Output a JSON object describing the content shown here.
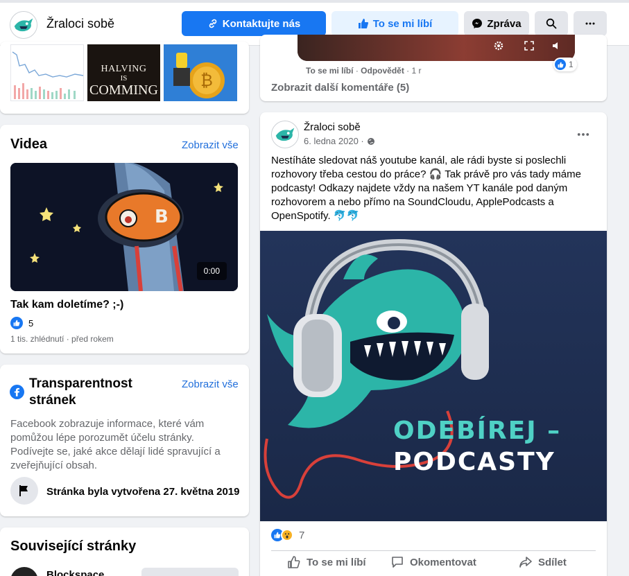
{
  "header": {
    "page_name": "Žraloci sobě",
    "contact_label": "Kontaktujte nás",
    "like_label": "To se mi líbí",
    "message_label": "Zpráva"
  },
  "photos": {
    "halving_text_1": "HALVING",
    "halving_text_2": "IS",
    "halving_text_3": "COMMING"
  },
  "videos": {
    "title": "Videa",
    "see_all": "Zobrazit vše",
    "duration": "0:00",
    "video_title": "Tak kam doletíme? ;-)",
    "likes": "5",
    "meta": "1 tis. zhlédnutí · před rokem"
  },
  "transparency": {
    "title_line1": "Transparentnost",
    "title_line2": "stránek",
    "see_all": "Zobrazit vše",
    "desc_line1": "Facebook zobrazuje informace, které vám",
    "desc_line2": "pomůžou lépe porozumět účelu stránky.",
    "desc_line3": "Podívejte se, jaké akce dělají lidé spravující a",
    "desc_line4": "zveřejňující obsah.",
    "created": "Stránka byla vytvořena 27. května 2019"
  },
  "related": {
    "title": "Související stránky",
    "first_page": "Blockspace"
  },
  "comment": {
    "like_link": "To se mi líbí",
    "reply_link": "Odpovědět",
    "time": "1 r",
    "reaction_count": "1",
    "more_comments": "Zobrazit další komentáře (5)"
  },
  "post": {
    "author": "Žraloci sobě",
    "date": "6. ledna 2020 ·",
    "text_line1": "Nestíháte sledovat náš youtube kanál, ale rádi byste si poslechli",
    "text_line2": "rozhovory třeba cestou do práce? 🎧 Tak právě pro vás tady máme",
    "text_line3": "podcasty! Odkazy najdete vždy na našem YT kanále pod daným",
    "text_line4": "rozhovorem a nebo přímo na SoundCloudu, ApplePodcasts a",
    "text_line5": "OpenSpotify. 🐬🐬",
    "image_line1": "ODEBÍREJ –",
    "image_line2": "PODCASTY",
    "reaction_count": "7",
    "action_like": "To se mi líbí",
    "action_comment": "Okomentovat",
    "action_share": "Sdílet"
  },
  "colors": {
    "accent": "#1877f2",
    "shark": "#2cb5a8",
    "podcast_bg": "#1b2a4a",
    "podcast_text": "#4fd1c5"
  }
}
